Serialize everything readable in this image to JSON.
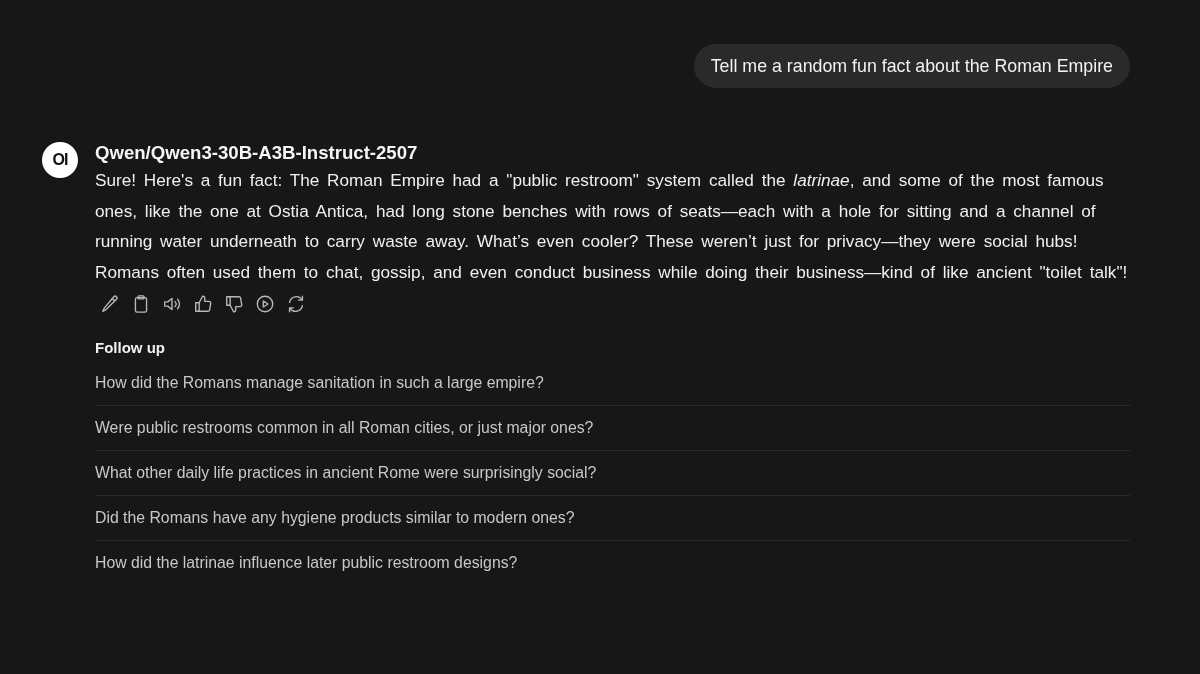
{
  "user_message": {
    "text": "Tell me a random fun fact about the Roman Empire"
  },
  "assistant": {
    "avatar_label": "OI",
    "model": "Qwen/Qwen3-30B-A3B-Instruct-2507",
    "message": "Sure! Here's a fun fact: The Roman Empire had a \"public restroom\" system called the *latrinae*, and some of the most famous ones, like the one at Ostia Antica, had long stone benches with rows of seats—each with a hole for sitting and a channel of running water underneath to carry waste away. What’s even cooler? These weren’t just for privacy—they were social hubs! Romans often used them to chat, gossip, and even conduct business while doing their business—kind of like ancient \"toilet talk\"!"
  },
  "follow_up": {
    "title": "Follow up",
    "items": [
      "How did the Romans manage sanitation in such a large empire?",
      "Were public restrooms common in all Roman cities, or just major ones?",
      "What other daily life practices in ancient Rome were surprisingly social?",
      "Did the Romans have any hygiene products similar to modern ones?",
      "How did the latrinae influence later public restroom designs?"
    ]
  }
}
